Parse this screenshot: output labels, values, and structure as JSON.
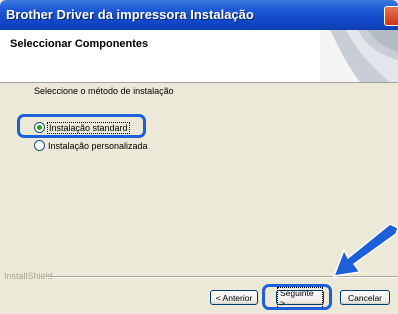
{
  "window": {
    "title": "Brother Driver da impressora Instalação"
  },
  "header": {
    "title": "Seleccionar Componentes"
  },
  "body": {
    "instruction": "Seleccione o método de instalação",
    "options": [
      {
        "label": "Instalação standard",
        "selected": true
      },
      {
        "label": "Instalação personalizada",
        "selected": false
      }
    ]
  },
  "footer": {
    "brand": "InstallShield",
    "back_label": "< Anterior",
    "next_label": "Seguinte >",
    "cancel_label": "Cancelar"
  },
  "colors": {
    "title_bar": "#1248C8",
    "highlight": "#1C5FD8",
    "radio_dot": "#21A121",
    "dialog_bg": "#ECE9D8"
  }
}
